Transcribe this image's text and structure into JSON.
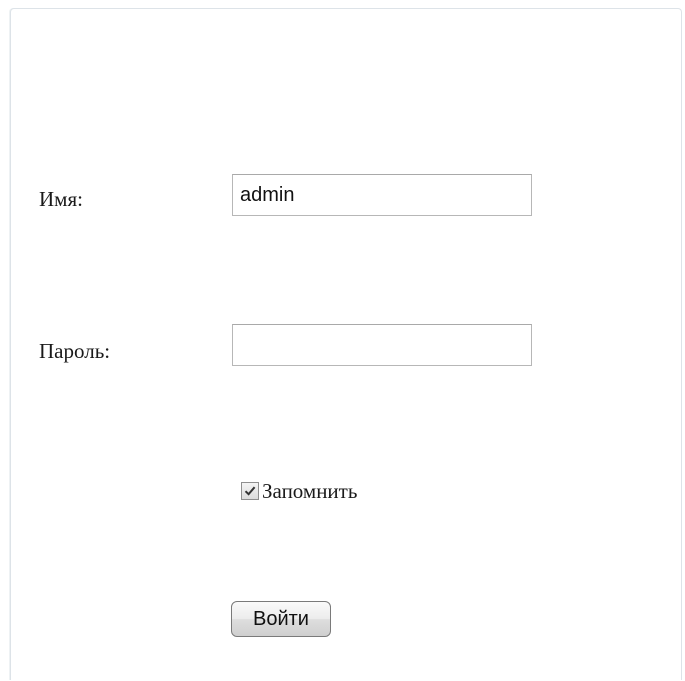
{
  "form": {
    "username_label": "Имя:",
    "username_value": "admin",
    "password_label": "Пароль:",
    "password_value": "",
    "remember_label": "Запомнить",
    "remember_checked": true,
    "submit_label": "Войти"
  },
  "icons": {
    "checkbox": "checkmark-icon"
  }
}
